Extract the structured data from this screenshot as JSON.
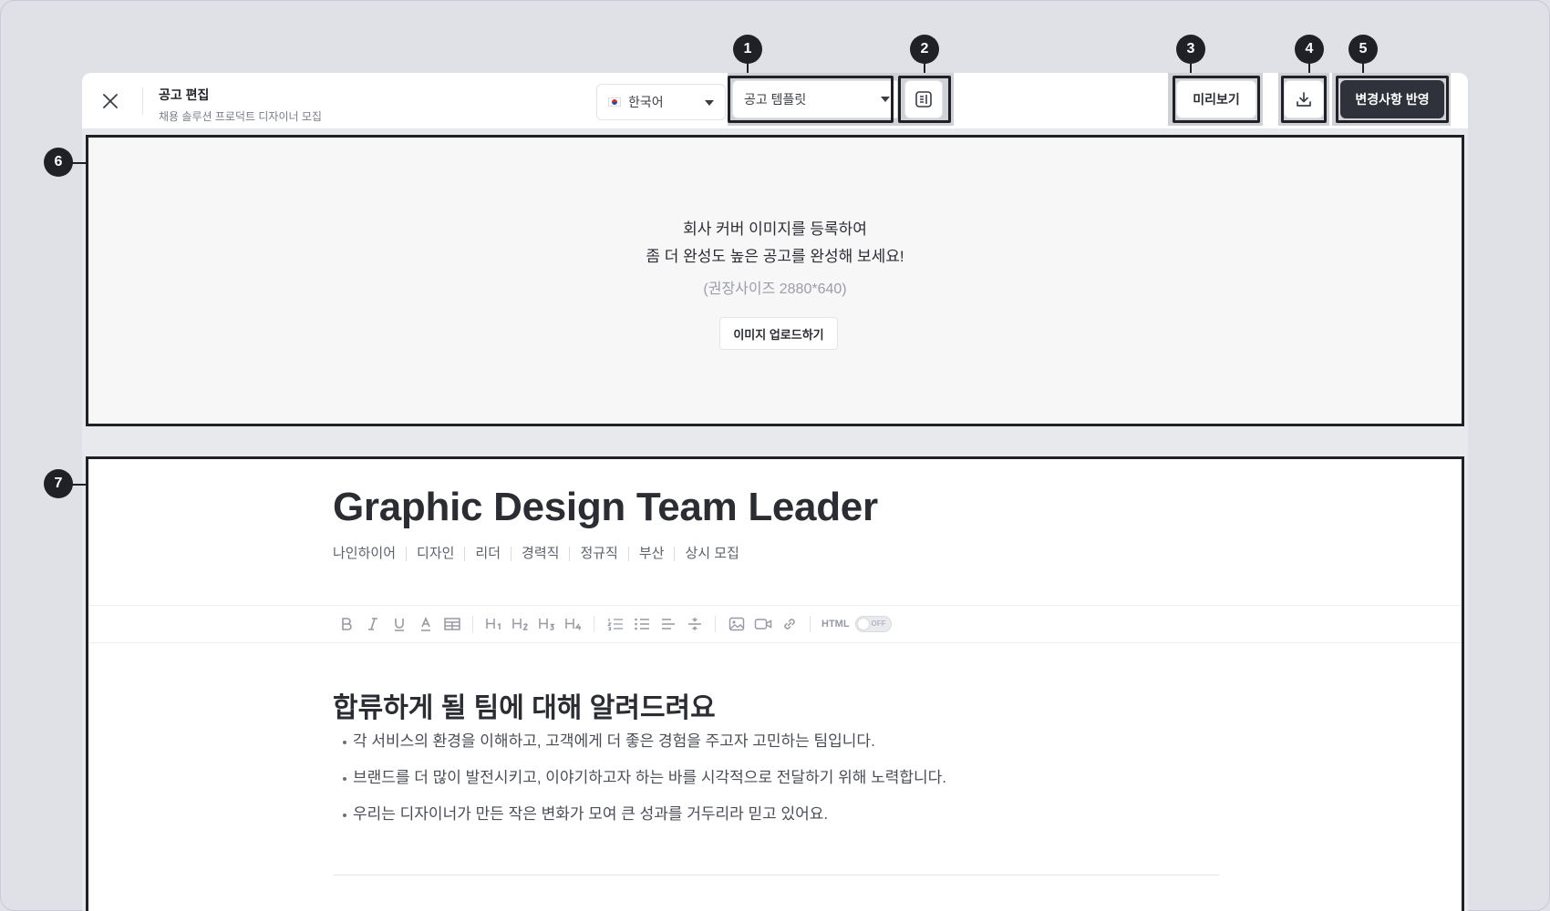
{
  "header": {
    "title": "공고 편집",
    "subtitle": "채용 솔루션 프로덕트 디자이너 모집",
    "language": "한국어",
    "template": "공고 템플릿",
    "preview_label": "미리보기",
    "apply_label": "변경사항 반영"
  },
  "cover": {
    "line1": "회사 커버 이미지를 등록하여",
    "line2": "좀 더 완성도 높은 공고를 완성해 보세요!",
    "size_hint": "(권장사이즈 2880*640)",
    "upload_label": "이미지 업로드하기"
  },
  "editor": {
    "job_title": "Graphic Design Team Leader",
    "tags": [
      "나인하이어",
      "디자인",
      "리더",
      "경력직",
      "정규직",
      "부산",
      "상시 모집"
    ],
    "toolbar": {
      "html_label": "HTML",
      "toggle_label": "OFF"
    },
    "section_heading": "합류하게 될 팀에 대해 알려드려요",
    "bullets": [
      "각 서비스의 환경을 이해하고, 고객에게 더 좋은 경험을 주고자 고민하는 팀입니다.",
      "브랜드를 더 많이 발전시키고, 이야기하고자 하는 바를 시각적으로 전달하기 위해 노력합니다.",
      "우리는 디자이너가 만든 작은 변화가 모여 큰 성과를 거두리라 믿고 있어요."
    ]
  },
  "markers": [
    "1",
    "2",
    "3",
    "4",
    "5",
    "6",
    "7"
  ],
  "colors": {
    "background": "#dfe1e6",
    "primary_button": "#2f323a",
    "marker": "#1f2126"
  }
}
